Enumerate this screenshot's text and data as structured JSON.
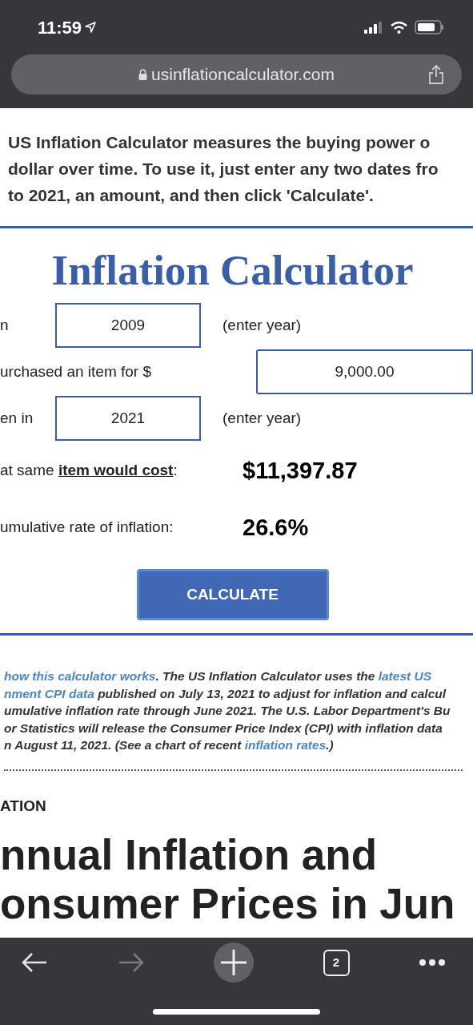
{
  "status_bar": {
    "time": "11:59"
  },
  "address_bar": {
    "url": "usinflationcalculator.com"
  },
  "intro_lines": [
    "US Inflation Calculator measures the buying power o",
    "dollar over time. To use it, just enter any two dates fro",
    "to 2021, an amount, and then click 'Calculate'."
  ],
  "calculator": {
    "title": "Inflation Calculator",
    "rows": [
      {
        "kind": "input",
        "label": "n",
        "value": "2009",
        "hint": "(enter year)"
      },
      {
        "kind": "wide_input",
        "label": "urchased an item for $",
        "value": "9,000.00"
      },
      {
        "kind": "input",
        "label": "en in",
        "value": "2021",
        "hint": "(enter year)"
      },
      {
        "kind": "result",
        "label": "at same **item would cost**:",
        "value": "$11,397.87"
      },
      {
        "kind": "result",
        "label": "umulative rate of inflation:",
        "value": "26.6%"
      }
    ],
    "button": "CALCULATE"
  },
  "note_lines": [
    [
      {
        "kind": "link",
        "text": "how this calculator works"
      },
      {
        "kind": "text",
        "text": ". The US Inflation Calculator uses the "
      },
      {
        "kind": "link",
        "text": "latest US"
      }
    ],
    [
      {
        "kind": "link",
        "text": "nment CPI data"
      },
      {
        "kind": "text",
        "text": " published on July 13, 2021 to adjust for inflation and calcul"
      }
    ],
    [
      {
        "kind": "text",
        "text": "umulative inflation rate through June 2021. The U.S. Labor Department's Bu"
      }
    ],
    [
      {
        "kind": "text",
        "text": "or Statistics will release the Consumer Price Index (CPI) with inflation data"
      }
    ],
    [
      {
        "kind": "text",
        "text": "n August 11, 2021. (See a chart of recent "
      },
      {
        "kind": "link",
        "text": "inflation rates"
      },
      {
        "kind": "text",
        "text": ".)"
      }
    ]
  ],
  "section_label": "ATION",
  "headline_lines": [
    "nnual Inflation and",
    "onsumer Prices in Jun"
  ],
  "toolbar": {
    "tab_count": "2",
    "forward_disabled": true
  }
}
